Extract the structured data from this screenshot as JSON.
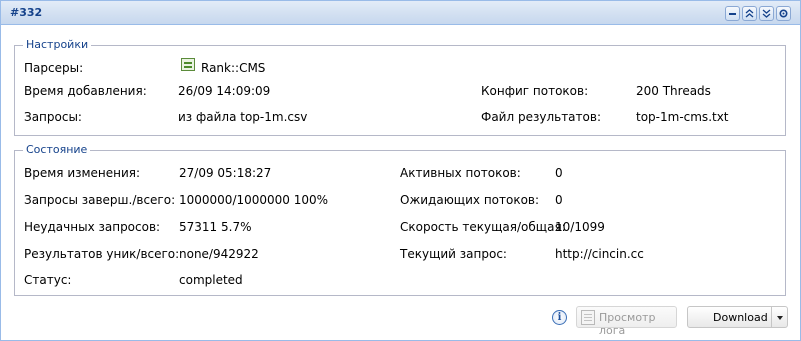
{
  "panel": {
    "title": "#332",
    "tools": [
      "minimize-icon",
      "collapse-up-icon",
      "collapse-down-icon",
      "settings-icon"
    ]
  },
  "settings": {
    "legend": "Настройки",
    "parsers_label": "Парсеры:",
    "parsers_value": "Rank::CMS",
    "added_label": "Время добавления:",
    "added_value": "26/09 14:09:09",
    "threads_config_label": "Конфиг потоков:",
    "threads_config_value": "200 Threads",
    "queries_label": "Запросы:",
    "queries_value": "из файла top-1m.csv",
    "result_file_label": "Файл результатов:",
    "result_file_value": "top-1m-cms.txt"
  },
  "state": {
    "legend": "Состояние",
    "changed_label": "Время изменения:",
    "changed_value": "27/09 05:18:27",
    "done_label": "Запросы заверш./всего:",
    "done_value": "1000000/1000000 100%",
    "failed_label": "Неудачных запросов:",
    "failed_value": "57311 5.7%",
    "results_label": "Результатов уник/всего:",
    "results_value": "none/942922",
    "status_label": "Статус:",
    "status_value": "completed",
    "active_label": "Активных потоков:",
    "active_value": "0",
    "waiting_label": "Ожидающих потоков:",
    "waiting_value": "0",
    "speed_label": "Скорость текущая/общая:",
    "speed_value": "10/1099",
    "current_label": "Текущий запрос:",
    "current_value": "http://cincin.cc"
  },
  "footer": {
    "info_icon": "info-icon",
    "view_log_label": "Просмотр лога",
    "view_log_enabled": false,
    "download_label": "Download"
  },
  "colors": {
    "accent": "#15428b",
    "header_border": "#99bbe8",
    "fieldset_border": "#b5b8c8"
  }
}
